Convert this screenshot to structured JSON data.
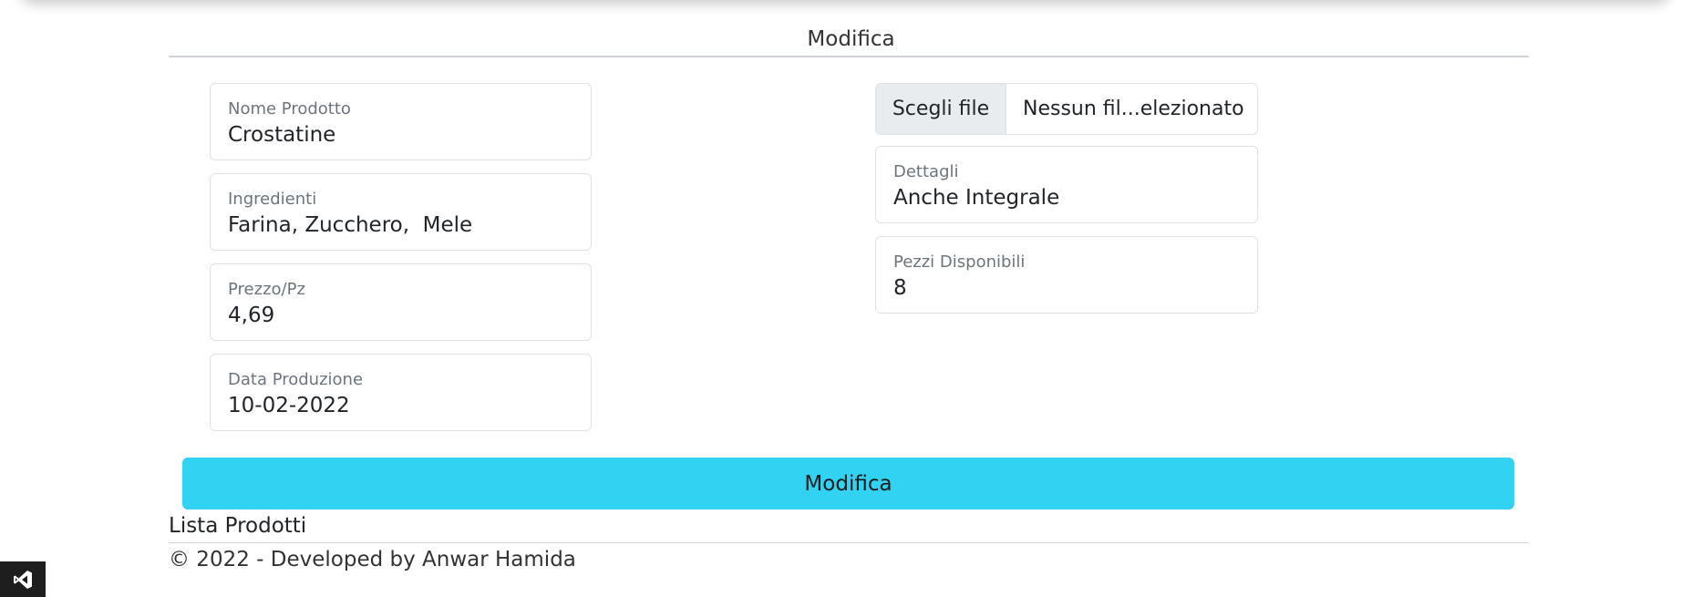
{
  "header": {
    "title": "Modifica"
  },
  "form": {
    "left_fields": [
      {
        "label": "Nome Prodotto",
        "value": "Crostatine"
      },
      {
        "label": "Ingredienti",
        "value": "Farina, Zucchero,  Mele"
      },
      {
        "label": "Prezzo/Pz",
        "value": "4,69"
      },
      {
        "label": "Data Produzione",
        "value": "10-02-2022"
      }
    ],
    "file_input": {
      "button_label": "Scegli file",
      "file_name": "Nessun fil...elezionato"
    },
    "right_fields": [
      {
        "label": "Dettagli",
        "value": "Anche Integrale"
      },
      {
        "label": "Pezzi Disponibili",
        "value": "8"
      }
    ],
    "submit_label": "Modifica",
    "submit_color": "#31d2f2"
  },
  "links": {
    "product_list": "Lista Prodotti"
  },
  "footer": {
    "text": "© 2022 - Developed by Anwar Hamida"
  },
  "icons": {
    "corner_badge": "visual-studio-icon"
  }
}
